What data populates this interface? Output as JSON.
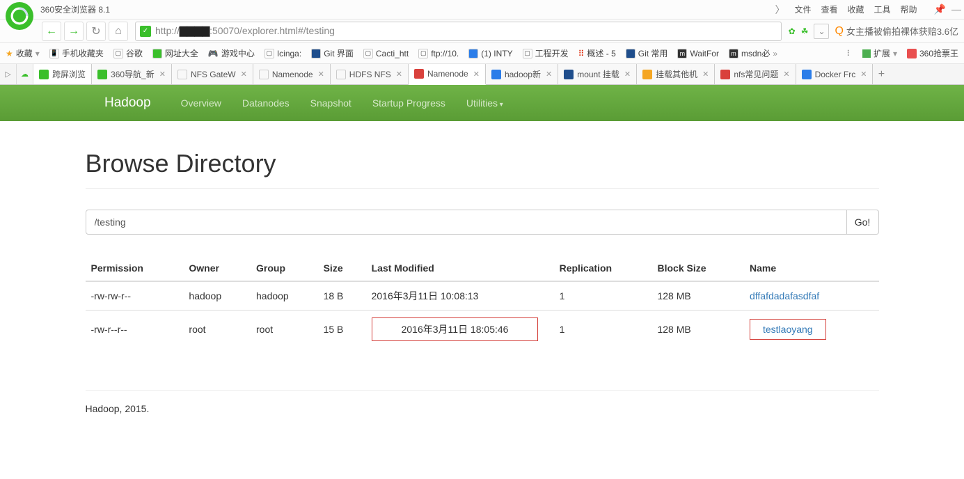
{
  "browser": {
    "title": "360安全浏览器 8.1",
    "menu": {
      "file": "文件",
      "view": "查看",
      "fav": "收藏",
      "tools": "工具",
      "help": "帮助"
    },
    "url_prefix": "http://",
    "url_host_obscured": "▇▇▇▇",
    "url_rest": ":50070/explorer.html#/testing",
    "search_placeholder": "女主播被偷拍裸体获赔3.6亿"
  },
  "bookmarks": {
    "fav_label": "收藏",
    "items": [
      "手机收藏夹",
      "谷歌",
      "网址大全",
      "游戏中心",
      "Icinga:",
      "Git 界面",
      "Cacti_htt",
      "ftp://10.",
      "(1) INTY",
      "工程开发",
      "概述 - 5",
      "Git 常用",
      "WaitFor",
      "msdn必"
    ],
    "ext_label": "扩展",
    "grab_label": "360抢票王"
  },
  "tabs": {
    "crossscreen": "跨屏浏览",
    "items": [
      {
        "label": "360导航_新"
      },
      {
        "label": "NFS GateW"
      },
      {
        "label": "Namenode"
      },
      {
        "label": "HDFS NFS"
      },
      {
        "label": "Namenode",
        "active": true
      },
      {
        "label": "hadoop新"
      },
      {
        "label": "mount 挂载"
      },
      {
        "label": "挂载其他机"
      },
      {
        "label": "nfs常见问题"
      },
      {
        "label": "Docker Frc"
      }
    ]
  },
  "nav": {
    "brand": "Hadoop",
    "overview": "Overview",
    "datanodes": "Datanodes",
    "snapshot": "Snapshot",
    "startup": "Startup Progress",
    "utilities": "Utilities"
  },
  "page": {
    "heading": "Browse Directory",
    "path": "/testing",
    "go": "Go!",
    "columns": {
      "perm": "Permission",
      "owner": "Owner",
      "group": "Group",
      "size": "Size",
      "lm": "Last Modified",
      "repl": "Replication",
      "bs": "Block Size",
      "name": "Name"
    },
    "rows": [
      {
        "perm": "-rw-rw-r--",
        "owner": "hadoop",
        "group": "hadoop",
        "size": "18 B",
        "lm": "2016年3月11日 10:08:13",
        "repl": "1",
        "bs": "128 MB",
        "name": "dffafdadafasdfaf",
        "hl_lm": false,
        "hl_name": false
      },
      {
        "perm": "-rw-r--r--",
        "owner": "root",
        "group": "root",
        "size": "15 B",
        "lm": "2016年3月11日 18:05:46",
        "repl": "1",
        "bs": "128 MB",
        "name": "testlaoyang",
        "hl_lm": true,
        "hl_name": true
      }
    ],
    "footer": "Hadoop, 2015."
  }
}
